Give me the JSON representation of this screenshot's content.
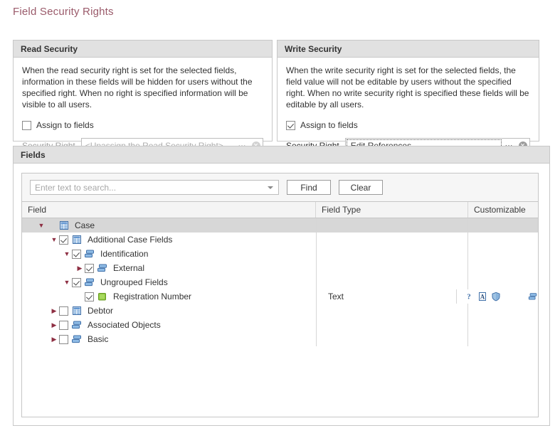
{
  "page": {
    "title": "Field Security Rights"
  },
  "read_security": {
    "header": "Read Security",
    "description": "When the read security right is set for the selected fields, information in these fields will be hidden for users without the specified right. When no right is specified information will be visible to all users.",
    "assign_label": "Assign to fields",
    "assign_checked": false,
    "security_right_label": "Security Right",
    "security_right_value": "<Unassign the Read Security Right>",
    "ellipsis_label": "•••",
    "enabled": false
  },
  "write_security": {
    "header": "Write Security",
    "description": "When the write security right is set for the selected fields, the field value will not be editable by users without the specified right. When no write security right is specified these fields will be editable by all users.",
    "assign_label": "Assign to fields",
    "assign_checked": true,
    "security_right_label": "Security Right",
    "security_right_value": "Edit References",
    "ellipsis_label": "•••",
    "enabled": true
  },
  "fields": {
    "header": "Fields",
    "search": {
      "placeholder": "Enter text to search...",
      "value": "",
      "find_label": "Find",
      "clear_label": "Clear"
    },
    "columns": [
      "Field",
      "Field Type",
      "Customizable"
    ],
    "rows": [
      {
        "label": "Case",
        "depth": 0,
        "expanded": true,
        "checkbox": "none",
        "icon": "table-icon",
        "field_type": "",
        "selected": true,
        "custom_icons": []
      },
      {
        "label": "Additional Case Fields",
        "depth": 1,
        "expanded": true,
        "checkbox": "checked",
        "icon": "table-icon",
        "field_type": "",
        "selected": false,
        "custom_icons": []
      },
      {
        "label": "Identification",
        "depth": 2,
        "expanded": true,
        "checkbox": "checked",
        "icon": "group-icon",
        "field_type": "",
        "selected": false,
        "custom_icons": []
      },
      {
        "label": "External",
        "depth": 3,
        "expanded": false,
        "checkbox": "checked",
        "icon": "group-icon",
        "field_type": "",
        "selected": false,
        "custom_icons": []
      },
      {
        "label": "Ungrouped Fields",
        "depth": 2,
        "expanded": true,
        "checkbox": "checked",
        "icon": "group-icon",
        "field_type": "",
        "selected": false,
        "custom_icons": []
      },
      {
        "label": "Registration Number",
        "depth": 3,
        "expanded": null,
        "checkbox": "checked",
        "icon": "field-icon",
        "field_type": "Text",
        "selected": false,
        "custom_icons": [
          "question-icon",
          "letter-a-icon",
          "shield-icon",
          "group-icon"
        ]
      },
      {
        "label": "Debtor",
        "depth": 1,
        "expanded": false,
        "checkbox": "unchecked",
        "icon": "table-icon",
        "field_type": "",
        "selected": false,
        "custom_icons": []
      },
      {
        "label": "Associated Objects",
        "depth": 1,
        "expanded": false,
        "checkbox": "unchecked",
        "icon": "group-icon",
        "field_type": "",
        "selected": false,
        "custom_icons": []
      },
      {
        "label": "Basic",
        "depth": 1,
        "expanded": false,
        "checkbox": "unchecked",
        "icon": "group-icon",
        "field_type": "",
        "selected": false,
        "custom_icons": []
      }
    ]
  },
  "colors": {
    "title": "#9a5a6a",
    "panel_header_bg": "#e1e1e1",
    "border": "#c8c8c8",
    "selected_row": "#d7d7d7",
    "twisty": "#8e2f43",
    "icon_blue": "#4a7ebb",
    "icon_green": "#8cc63f"
  }
}
